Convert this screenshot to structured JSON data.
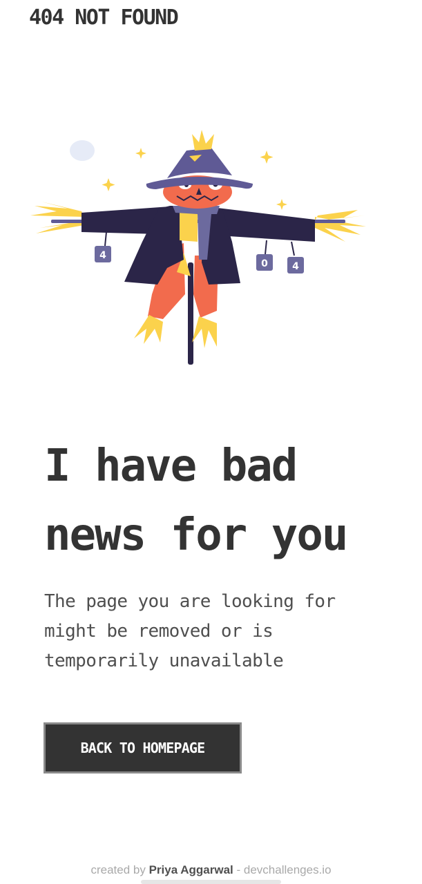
{
  "header": {
    "brand": "404 NOT FOUND"
  },
  "illustration": {
    "icon": "scarecrow-illustration",
    "can_labels": [
      "4",
      "0",
      "4"
    ],
    "colors": {
      "hat": "#5f5a95",
      "coat": "#2b2548",
      "face": "#f26b4d",
      "straw": "#fbd24c",
      "scarf": "#6c6a9e",
      "pole": "#2b2548",
      "moon": "#e6ebf7"
    }
  },
  "main": {
    "headline_lines": [
      "I have bad",
      "news for you"
    ],
    "message_lines": [
      "The page you are looking for",
      "might be removed or is",
      "temporarily unavailable"
    ],
    "button_label": "BACK TO HOMEPAGE"
  },
  "footer": {
    "prefix": "created by ",
    "author": "Priya Aggarwal",
    "separator": " - ",
    "site": "devchallenges.io"
  }
}
